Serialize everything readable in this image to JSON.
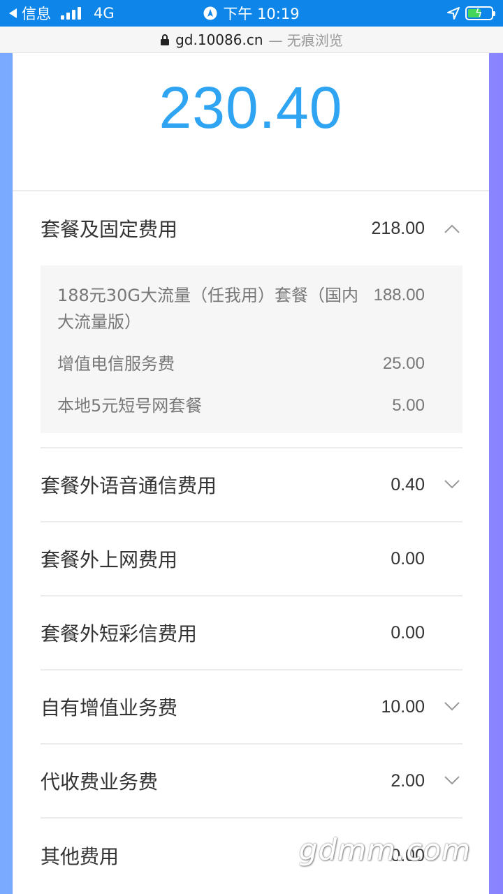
{
  "status_bar": {
    "back_app": "信息",
    "network": "4G",
    "time": "下午 10:19"
  },
  "url_bar": {
    "domain": "gd.10086.cn",
    "suffix": "— 无痕浏览"
  },
  "bill": {
    "total": "230.40",
    "categories": [
      {
        "label": "套餐及固定费用",
        "amount": "218.00",
        "expanded": true,
        "items": [
          {
            "label": "188元30G大流量（任我用）套餐（国内大流量版）",
            "amount": "188.00"
          },
          {
            "label": "增值电信服务费",
            "amount": "25.00"
          },
          {
            "label": "本地5元短号网套餐",
            "amount": "5.00"
          }
        ]
      },
      {
        "label": "套餐外语音通信费用",
        "amount": "0.40",
        "expandable": true
      },
      {
        "label": "套餐外上网费用",
        "amount": "0.00",
        "expandable": false
      },
      {
        "label": "套餐外短彩信费用",
        "amount": "0.00",
        "expandable": false
      },
      {
        "label": "自有增值业务费",
        "amount": "10.00",
        "expandable": true
      },
      {
        "label": "代收费业务费",
        "amount": "2.00",
        "expandable": true
      },
      {
        "label": "其他费用",
        "amount": "0.00",
        "expandable": false
      }
    ]
  },
  "watermark": "gdmm.com",
  "colors": {
    "status_bar": "#0e86e9",
    "total_amount": "#2fa4f3",
    "battery": "#43d65b"
  }
}
